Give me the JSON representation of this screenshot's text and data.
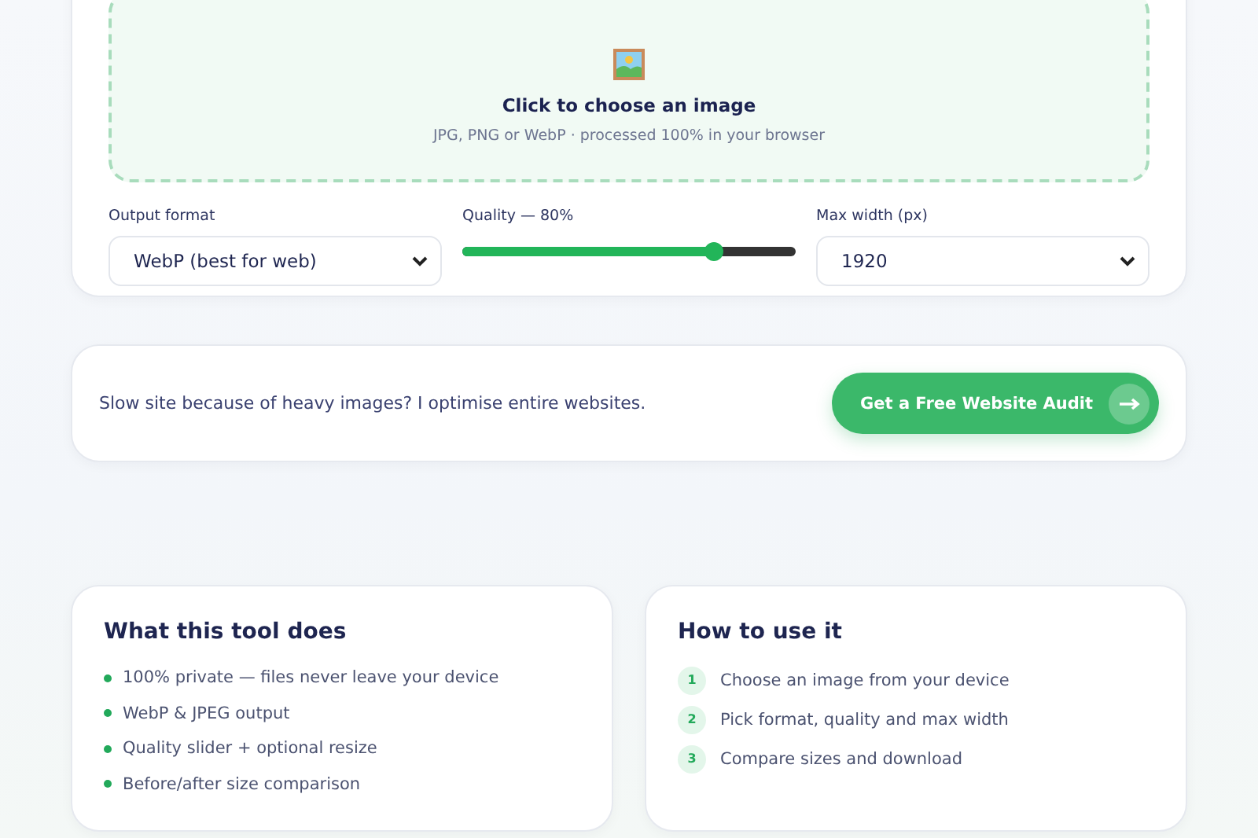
{
  "upload": {
    "title": "Click to choose an image",
    "hint": "JPG, PNG or WebP · processed 100% in your browser"
  },
  "controls": [
    {
      "kind": "select",
      "label": "Output format",
      "value": "WebP (best for web)"
    },
    {
      "kind": "slider",
      "label": "Quality — 80%",
      "level": 0.755
    },
    {
      "kind": "select",
      "label": "Max width (px)",
      "value": "1920"
    }
  ],
  "cta": {
    "text": "Slow site because of heavy images? I optimise entire websites.",
    "button": "Get a Free Website Audit"
  },
  "features": {
    "title": "What this tool does",
    "items": [
      "100% private — files never leave your device",
      "WebP & JPEG output",
      "Quality slider + optional resize",
      "Before/after size comparison"
    ]
  },
  "steps": {
    "title": "How to use it",
    "items": [
      {
        "number": "1",
        "text": "Choose an image from your device"
      },
      {
        "number": "2",
        "text": "Pick format, quality and max width"
      },
      {
        "number": "3",
        "text": "Compare sizes and download"
      }
    ]
  }
}
